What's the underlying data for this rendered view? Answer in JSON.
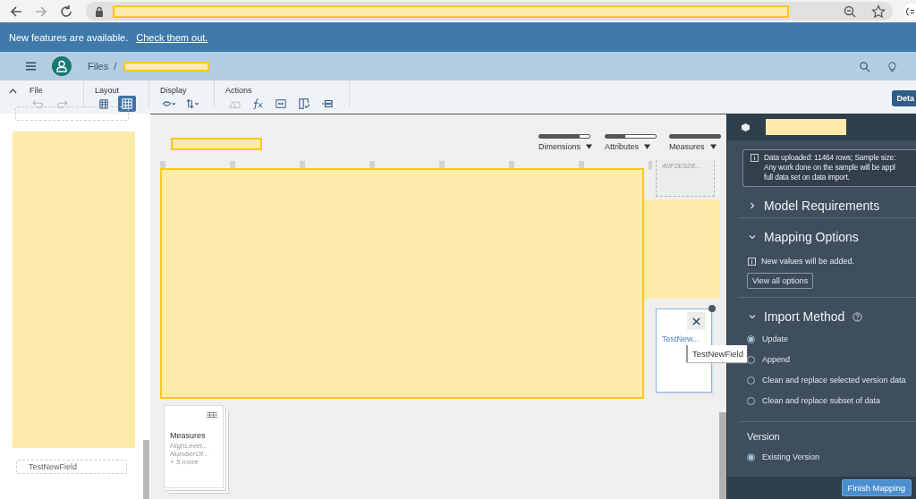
{
  "banner": {
    "message": "New features are available.",
    "link": "Check them out."
  },
  "shell": {
    "breadcrumb": "Files",
    "separator": "/"
  },
  "toolbar": {
    "groups": [
      {
        "label": "File",
        "tools": [
          {
            "kind": "undo",
            "disabled": true
          },
          {
            "kind": "redo",
            "disabled": true
          }
        ]
      },
      {
        "label": "Layout",
        "tools": [
          {
            "kind": "calendar",
            "selected": false
          },
          {
            "kind": "table",
            "selected": true
          }
        ]
      },
      {
        "label": "Display",
        "tools": [
          {
            "kind": "eye-dropdown"
          },
          {
            "kind": "sort-dropdown"
          }
        ]
      },
      {
        "label": "Actions",
        "tools": [
          {
            "kind": "shapes",
            "disabled": true
          },
          {
            "kind": "formula",
            "disabled": false
          },
          {
            "kind": "split",
            "disabled": false
          },
          {
            "kind": "column-check",
            "disabled": false
          },
          {
            "kind": "align",
            "disabled": false
          }
        ]
      }
    ],
    "details_button": "Deta"
  },
  "left_panel": {
    "fields": [
      "TestNewField"
    ]
  },
  "canvas": {
    "column_filters": [
      {
        "label": "Dimensions",
        "level": 0.8
      },
      {
        "label": "Attributes",
        "level": 0.4
      },
      {
        "label": "Measures",
        "level": 1
      }
    ],
    "cards": [
      {
        "kind": "dashed",
        "lines": [
          "40F2E928..."
        ]
      },
      {
        "kind": "selected",
        "title": "TestNew..."
      },
      {
        "kind": "group",
        "title": "Measures",
        "lines": [
          "HighLevel...",
          "NumberOf...",
          "+ 5 more"
        ]
      }
    ],
    "tooltip": "TestNewField"
  },
  "right_panel": {
    "info": [
      "Data uploaded: 11464 rows; Sample size:",
      "Any work done on the sample will be appl",
      "full data set on data import."
    ],
    "sections": [
      {
        "title": "Model Requirements",
        "expanded": false
      },
      {
        "title": "Mapping Options",
        "expanded": true,
        "note": "New values will be added.",
        "button": "View all options"
      },
      {
        "title": "Import Method",
        "expanded": true,
        "help": true,
        "options": [
          {
            "label": "Update",
            "selected": true
          },
          {
            "label": "Append",
            "selected": false
          },
          {
            "label": "Clean and replace selected version data",
            "selected": false
          },
          {
            "label": "Clean and replace subset of data",
            "selected": false
          }
        ]
      }
    ],
    "version": {
      "heading": "Version",
      "options": [
        {
          "label": "Existing Version",
          "selected": true
        }
      ]
    },
    "finish_button": "Finish Mapping"
  }
}
